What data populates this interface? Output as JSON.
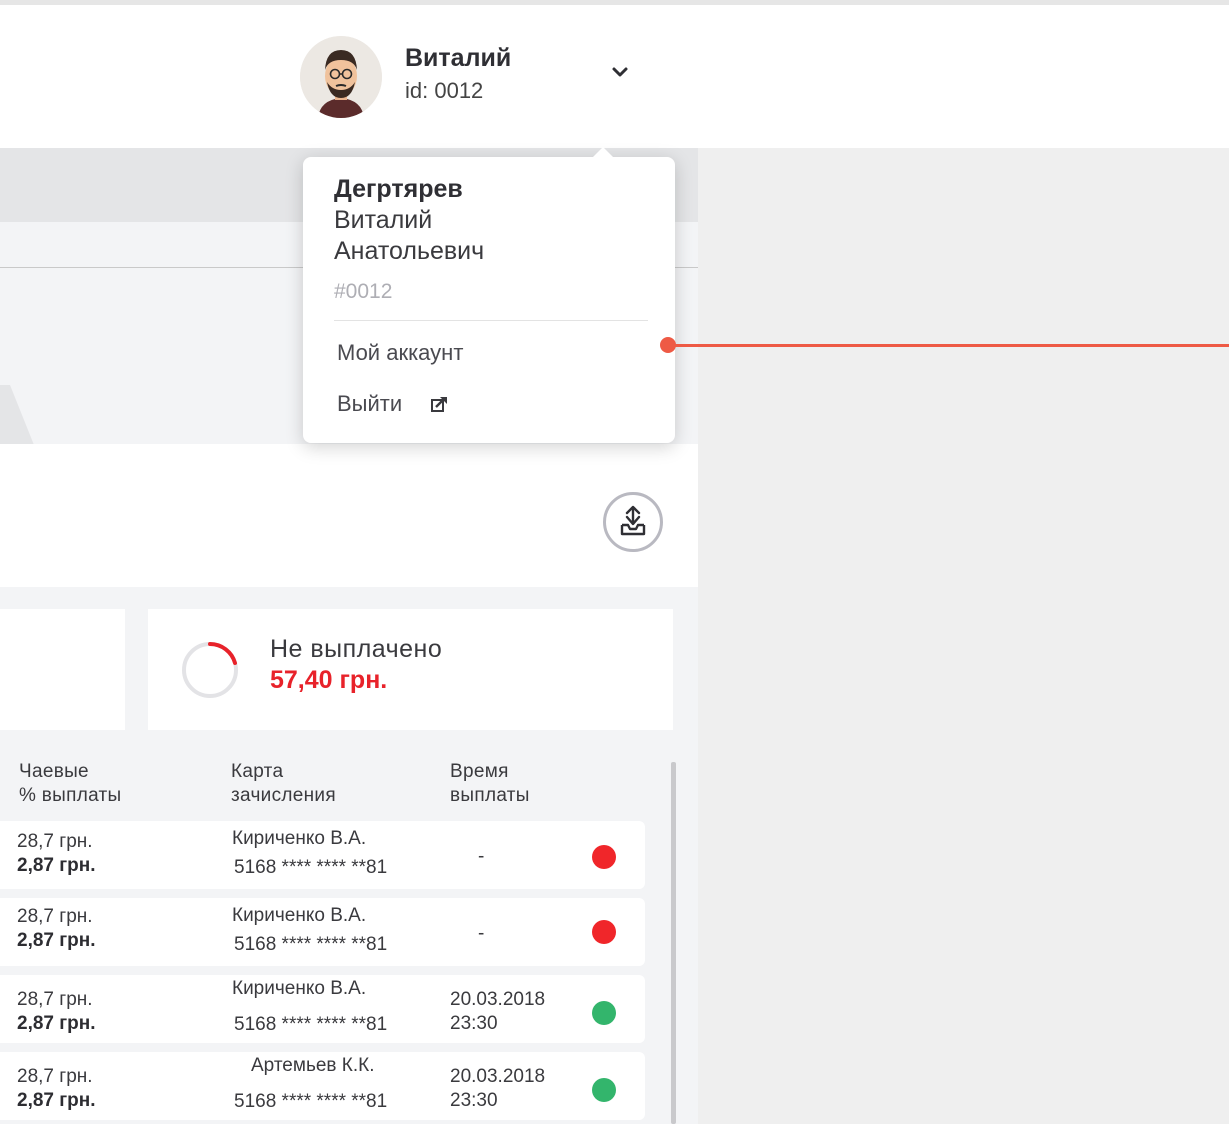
{
  "header": {
    "user_name": "Виталий",
    "user_id": "id: 0012"
  },
  "dropdown": {
    "surname": "Дегртярев",
    "first_name": "Виталий",
    "patronymic": "Анатольевич",
    "user_code": "#0012",
    "account_label": "Мой аккаунт",
    "logout_label": "Выйти"
  },
  "summary": {
    "unpaid_label": "Не выплачено",
    "unpaid_value": "57,40 грн."
  },
  "table": {
    "col_tips_line1": "Чаевые",
    "col_tips_line2": "% выплаты",
    "col_card_line1": "Карта",
    "col_card_line2": "зачисления",
    "col_time_line1": "Время",
    "col_time_line2": "выплаты",
    "rows": [
      {
        "tips": "28,7 грн.",
        "payout": "2,87 грн.",
        "holder": "Кириченко В.А.",
        "card": "5168 **** **** **81",
        "time_date": "",
        "time_hour": "",
        "dash": "-",
        "status": "unpaid"
      },
      {
        "tips": "28,7 грн.",
        "payout": "2,87 грн.",
        "holder": "Кириченко В.А.",
        "card": "5168 **** **** **81",
        "time_date": "",
        "time_hour": "",
        "dash": "-",
        "status": "unpaid"
      },
      {
        "tips": "28,7 грн.",
        "payout": "2,87 грн.",
        "holder": "Кириченко В.А.",
        "card": "5168 **** **** **81",
        "time_date": "20.03.2018",
        "time_hour": "23:30",
        "dash": "",
        "status": "paid"
      },
      {
        "tips": "28,7 грн.",
        "payout": "2,87 грн.",
        "holder": "Артемьев К.К.",
        "card": "5168 **** **** **81",
        "time_date": "20.03.2018",
        "time_hour": "23:30",
        "dash": "",
        "status": "paid"
      }
    ]
  },
  "colors": {
    "unpaid": "#f0262a",
    "paid": "#33b56c",
    "accent_red": "#e8222a",
    "callout": "#ee5a45"
  },
  "icons": {
    "chevron": "chevron-down-icon",
    "export": "export-icon",
    "logout": "logout-icon"
  }
}
